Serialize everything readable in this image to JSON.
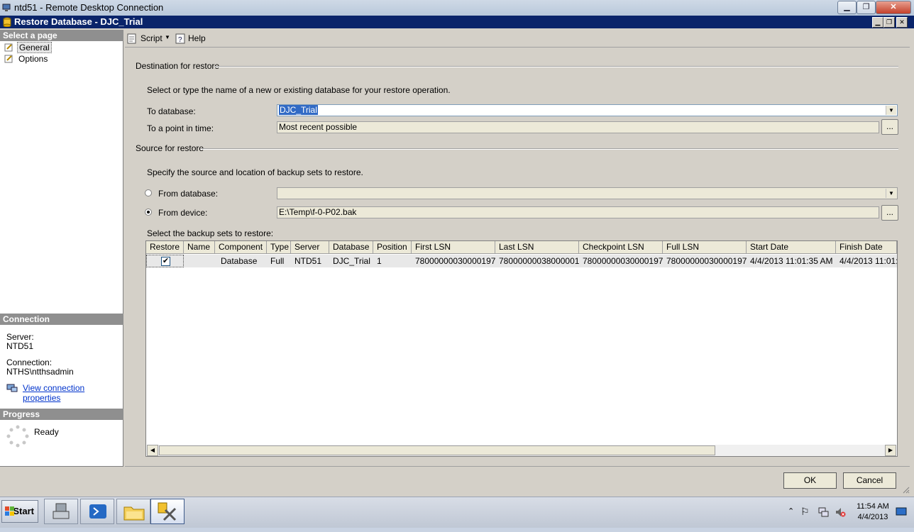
{
  "rdp": {
    "title": "ntd51 - Remote Desktop Connection"
  },
  "dialog": {
    "title": "Restore Database - DJC_Trial"
  },
  "left": {
    "select_page_header": "Select a page",
    "pages": [
      "General",
      "Options"
    ],
    "connection_header": "Connection",
    "server_label": "Server:",
    "server_value": "NTD51",
    "connection_label": "Connection:",
    "connection_value": "NTHS\\ntthsadmin",
    "view_connection_link": "View connection properties",
    "progress_header": "Progress",
    "progress_status": "Ready"
  },
  "toolbar": {
    "script_label": "Script",
    "help_label": "Help"
  },
  "destination": {
    "section_title": "Destination for restore",
    "instructions": "Select or type the name of a new or existing database for your restore operation.",
    "to_database_label": "To database:",
    "to_database_value": "DJC_Trial",
    "point_in_time_label": "To a point in time:",
    "point_in_time_value": "Most recent possible",
    "ellipsis": "..."
  },
  "source": {
    "section_title": "Source for restore",
    "instructions": "Specify the source and location of backup sets to restore.",
    "from_database_label": "From database:",
    "from_device_label": "From device:",
    "from_device_value": "E:\\Temp\\f-0-P02.bak",
    "ellipsis": "...",
    "selected_option": "From device"
  },
  "backup_sets": {
    "label": "Select the backup sets to restore:",
    "columns": [
      "Restore",
      "Name",
      "Component",
      "Type",
      "Server",
      "Database",
      "Position",
      "First LSN",
      "Last LSN",
      "Checkpoint LSN",
      "Full LSN",
      "Start Date",
      "Finish Date"
    ],
    "rows": [
      {
        "restore": true,
        "name": "",
        "component": "Database",
        "type": "Full",
        "server": "NTD51",
        "database": "DJC_Trial",
        "position": "1",
        "first_lsn": "78000000030000197",
        "last_lsn": "78000000038000001",
        "checkpoint_lsn": "78000000030000197",
        "full_lsn": "78000000030000197",
        "start_date": "4/4/2013 11:01:35 AM",
        "finish_date": "4/4/2013 11:01:"
      }
    ]
  },
  "buttons": {
    "ok": "OK",
    "cancel": "Cancel"
  },
  "taskbar": {
    "start_label": "Start",
    "clock_time": "11:54 AM",
    "clock_date": "4/4/2013"
  }
}
